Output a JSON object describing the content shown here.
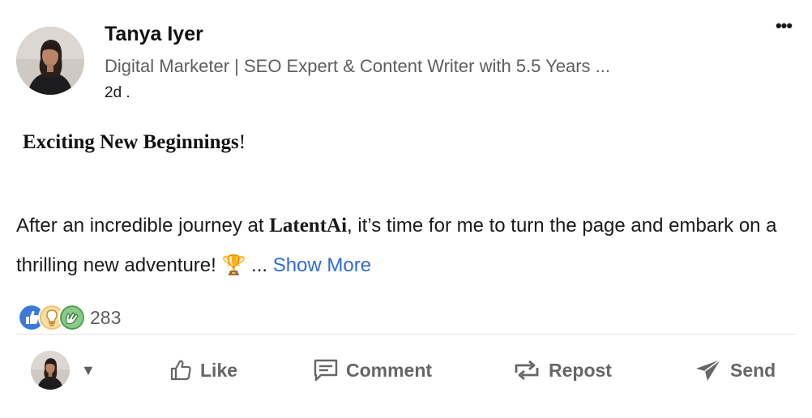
{
  "post": {
    "author_name": "Tanya Iyer",
    "author_headline": "Digital Marketer | SEO Expert & Content Writer with 5.5 Years ...",
    "timestamp": "2d .",
    "menu_label": "•••",
    "title": "Exciting New Beginnings",
    "title_punct": "!",
    "body_prefix": "After an incredible journey at ",
    "company": "LatentAi",
    "body_suffix": ", it’s time for me to turn the page and embark on a thrilling new adventure! 🏆 ... ",
    "show_more": "Show More"
  },
  "reactions": {
    "icons": [
      "like-icon",
      "insightful-icon",
      "celebrate-icon"
    ],
    "count": "283"
  },
  "actions": {
    "actor_caret": "▼",
    "like": "Like",
    "comment": "Comment",
    "repost": "Repost",
    "send": "Send"
  },
  "colors": {
    "accent_link": "#2f6bd6",
    "like_blue": "#3b7ad9",
    "insightful_gold": "#e7a33e",
    "celebrate_green": "#4c9e4f",
    "muted_text": "#5e5e5e"
  }
}
